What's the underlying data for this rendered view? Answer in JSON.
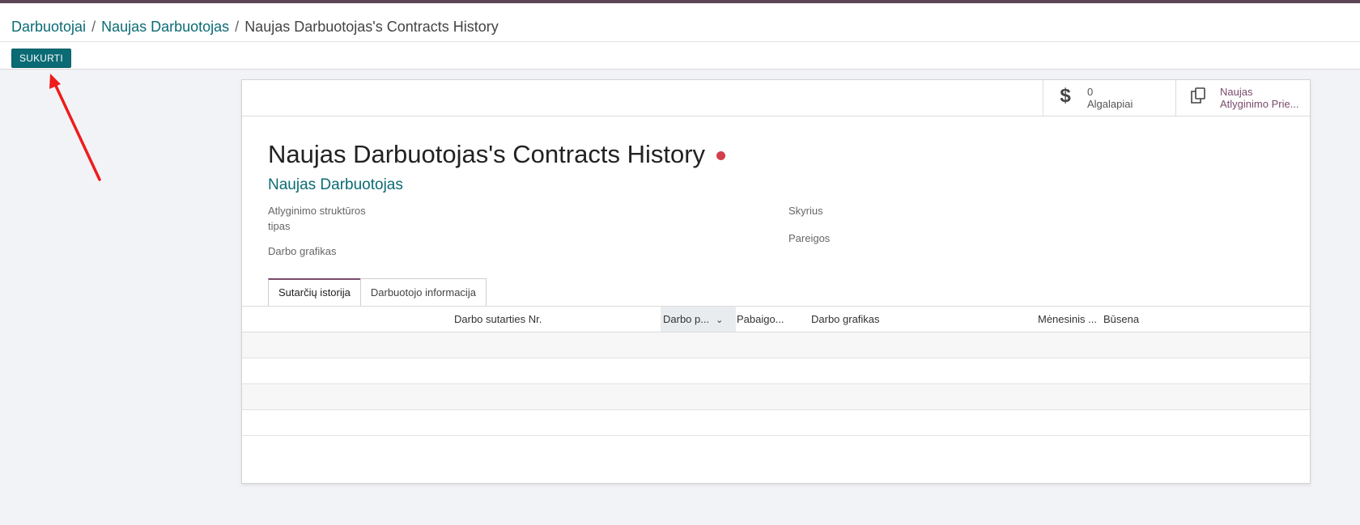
{
  "breadcrumb": {
    "items": [
      "Darbuotojai",
      "Naujas Darbuotojas"
    ],
    "current": "Naujas Darbuotojas's Contracts History",
    "separator": "/"
  },
  "toolbar": {
    "create_label": "SUKURTI"
  },
  "stat_buttons": {
    "payslips": {
      "count": "0",
      "label": "Algalapiai",
      "icon": "dollar-icon"
    },
    "contract": {
      "line1": "Naujas",
      "line2": "Atlyginimo Prie...",
      "icon": "copy-icon"
    }
  },
  "record": {
    "title": "Naujas Darbuotojas's Contracts History",
    "employee": "Naujas Darbuotojas",
    "status_color": "#d23f4c"
  },
  "fields": {
    "structure_type_line1": "Atlyginimo struktūros",
    "structure_type_line2": "tipas",
    "schedule": "Darbo grafikas",
    "department": "Skyrius",
    "job": "Pareigos"
  },
  "tabs": [
    {
      "label": "Sutarčių istorija",
      "active": true
    },
    {
      "label": "Darbuotojo informacija",
      "active": false
    }
  ],
  "table": {
    "columns": [
      "Darbo sutarties Nr.",
      "Darbo p...",
      "Pabaigo...",
      "Darbo grafikas",
      "Mėnesinis ...",
      "Būsena"
    ],
    "sorted_column": "Darbo p..."
  },
  "colors": {
    "accent": "#0b6b74",
    "brand": "#7a4a6c",
    "annotation_arrow": "#ee1c1c"
  }
}
